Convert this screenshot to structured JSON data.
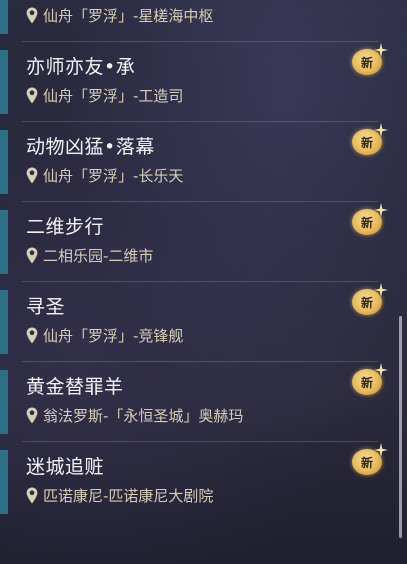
{
  "missions": [
    {
      "title": "",
      "location": "仙舟「罗浮」-星槎海中枢",
      "new_badge": false
    },
    {
      "title": "亦师亦友•承",
      "location": "仙舟「罗浮」-工造司",
      "new_badge": true
    },
    {
      "title": "动物凶猛•落幕",
      "location": "仙舟「罗浮」-长乐天",
      "new_badge": true
    },
    {
      "title": "二维步行",
      "location": "二相乐园-二维市",
      "new_badge": true
    },
    {
      "title": "寻圣",
      "location": "仙舟「罗浮」-竞锋舰",
      "new_badge": true
    },
    {
      "title": "黄金替罪羊",
      "location": "翁法罗斯-「永恒圣城」奥赫玛",
      "new_badge": true
    },
    {
      "title": "迷城追赃",
      "location": "匹诺康尼-匹诺康尼大剧院",
      "new_badge": true
    }
  ],
  "badge_label": "新",
  "icons": {
    "location": "location-pin-icon",
    "new": "new-badge-icon"
  },
  "colors": {
    "accent": "#2c6f87",
    "location_text": "#d8cdb6",
    "badge_gold": "#e7b95c"
  }
}
